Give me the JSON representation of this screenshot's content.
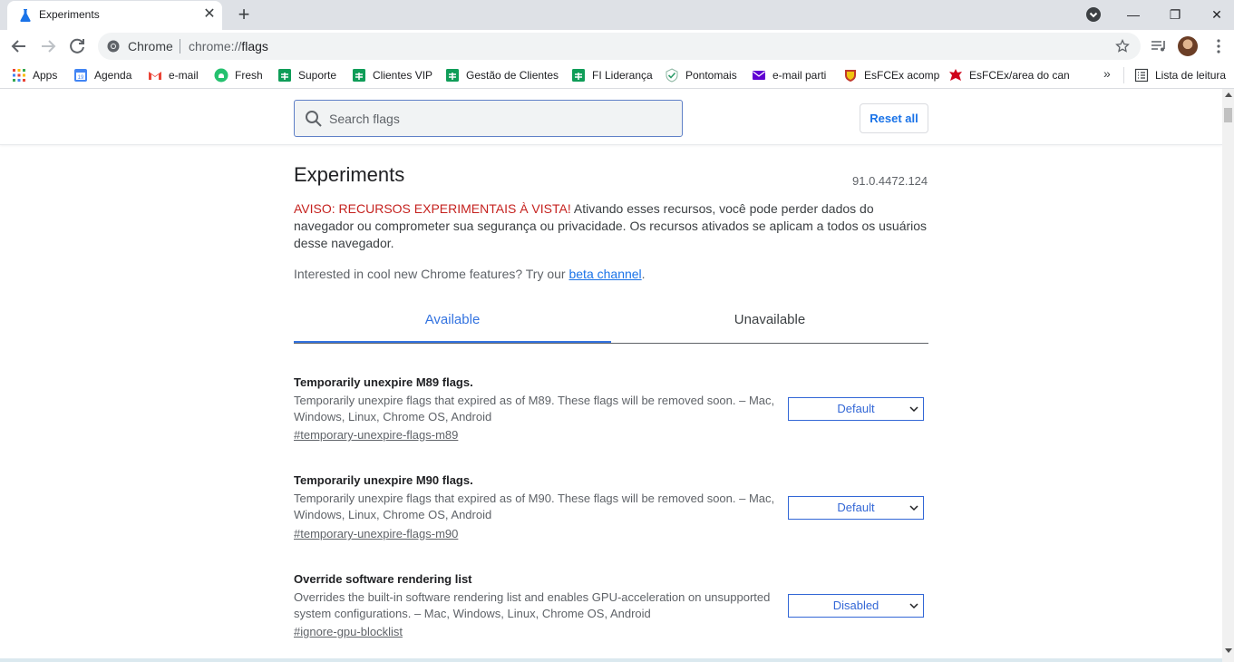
{
  "tab": {
    "title": "Experiments",
    "close_glyph": "✕",
    "new_tab_glyph": "+"
  },
  "window_controls": {
    "minimize": "—",
    "restore": "❐",
    "close": "✕"
  },
  "omnibox": {
    "site_name": "Chrome",
    "url_scheme": "chrome://",
    "url_path": "flags"
  },
  "bookmarks": {
    "items": [
      {
        "label": "Apps",
        "icon": "apps-grid-icon"
      },
      {
        "label": "Agenda",
        "icon": "calendar-icon"
      },
      {
        "label": "e-mail",
        "icon": "gmail-icon"
      },
      {
        "label": "Fresh",
        "icon": "freshdesk-icon"
      },
      {
        "label": "Suporte",
        "icon": "sheets-icon"
      },
      {
        "label": "Clientes VIP",
        "icon": "sheets-icon"
      },
      {
        "label": "Gestão de Clientes",
        "icon": "sheets-icon"
      },
      {
        "label": "FI Liderança",
        "icon": "sheets-icon"
      },
      {
        "label": "Pontomais",
        "icon": "check-shield-icon"
      },
      {
        "label": "e-mail parti",
        "icon": "mail-purple-icon"
      },
      {
        "label": "EsFCEx acomp",
        "icon": "crest-icon"
      },
      {
        "label": "EsFCEx/area do can",
        "icon": "red-emblem-icon"
      }
    ],
    "more_glyph": "»",
    "reading_list": "Lista de leitura"
  },
  "header": {
    "search_placeholder": "Search flags",
    "reset_label": "Reset all"
  },
  "content": {
    "title": "Experiments",
    "version": "91.0.4472.124",
    "warning_strong": "AVISO: RECURSOS EXPERIMENTAIS À VISTA!",
    "warning_text": " Ativando esses recursos, você pode perder dados do navegador ou comprometer sua segurança ou privacidade. Os recursos ativados se aplicam a todos os usuários desse navegador.",
    "promo_text": "Interested in cool new Chrome features? Try our ",
    "promo_link": "beta channel",
    "promo_end": ".",
    "tabs": [
      {
        "label": "Available",
        "active": true
      },
      {
        "label": "Unavailable",
        "active": false
      }
    ]
  },
  "experiments": [
    {
      "name": "Temporarily unexpire M89 flags.",
      "description": "Temporarily unexpire flags that expired as of M89. These flags will be removed soon. – Mac, Windows, Linux, Chrome OS, Android",
      "link": "#temporary-unexpire-flags-m89",
      "value": "Default"
    },
    {
      "name": "Temporarily unexpire M90 flags.",
      "description": "Temporarily unexpire flags that expired as of M90. These flags will be removed soon. – Mac, Windows, Linux, Chrome OS, Android",
      "link": "#temporary-unexpire-flags-m90",
      "value": "Default"
    },
    {
      "name": "Override software rendering list",
      "description": "Overrides the built-in software rendering list and enables GPU-acceleration on unsupported system configurations. – Mac, Windows, Linux, Chrome OS, Android",
      "link": "#ignore-gpu-blocklist",
      "value": "Disabled"
    }
  ],
  "colors": {
    "accent": "#1a73e8",
    "warning": "#c5221f",
    "tab_active": "#3373e0"
  }
}
